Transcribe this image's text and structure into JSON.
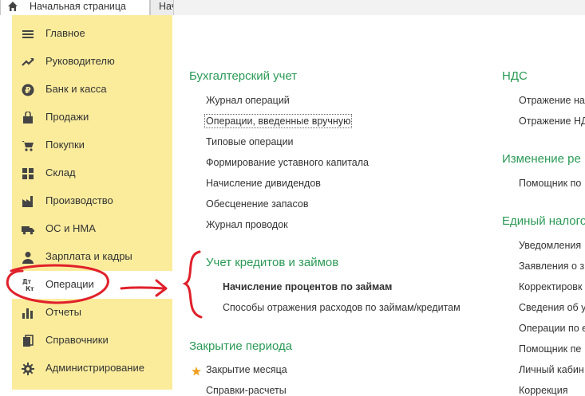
{
  "tabs": {
    "home": "Начальная страница",
    "next": "Нач"
  },
  "sidebar": {
    "items": [
      {
        "label": "Главное",
        "icon": "menu-icon"
      },
      {
        "label": "Руководителю",
        "icon": "trend-icon"
      },
      {
        "label": "Банк и касса",
        "icon": "ruble-icon"
      },
      {
        "label": "Продажи",
        "icon": "bag-icon"
      },
      {
        "label": "Покупки",
        "icon": "cart-icon"
      },
      {
        "label": "Склад",
        "icon": "grid-icon"
      },
      {
        "label": "Производство",
        "icon": "factory-icon"
      },
      {
        "label": "ОС и НМА",
        "icon": "truck-icon"
      },
      {
        "label": "Зарплата и кадры",
        "icon": "person-icon"
      },
      {
        "label": "Операции",
        "icon": "dt-kt-icon",
        "active": true
      },
      {
        "label": "Отчеты",
        "icon": "bar-chart-icon"
      },
      {
        "label": "Справочники",
        "icon": "books-icon"
      },
      {
        "label": "Администрирование",
        "icon": "gear-icon"
      }
    ],
    "dt_label": "Дт",
    "kt_label": "Кт"
  },
  "accounting": {
    "title": "Бухгалтерский учет",
    "links": [
      "Журнал операций",
      "Операции, введенные вручную",
      "Типовые операции",
      "Формирование уставного капитала",
      "Начисление дивидендов",
      "Обесценение запасов",
      "Журнал проводок"
    ]
  },
  "loans": {
    "title": "Учет кредитов и займов",
    "links": [
      "Начисление процентов по займам",
      "Способы отражения расходов по займам/кредитам"
    ]
  },
  "closing": {
    "title": "Закрытие периода",
    "links": [
      "Закрытие месяца",
      "Справки-расчеты"
    ]
  },
  "vat": {
    "title": "НДС",
    "links": [
      "Отражение на",
      "Отражение НД"
    ]
  },
  "change": {
    "title": "Изменение ре",
    "links": [
      "Помощник по"
    ]
  },
  "unified_tax": {
    "title": "Единый налого",
    "links": [
      "Уведомления",
      "Заявления о з",
      "Корректировк",
      "Сведения об у",
      "Операции по е",
      "Помощник пе",
      "Личный кабин",
      "Коррекция"
    ]
  },
  "colors": {
    "sidebar_bg": "#fbec9c",
    "section_title": "#2a9a56",
    "annotation": "#e0202a",
    "star": "#f0a020"
  }
}
